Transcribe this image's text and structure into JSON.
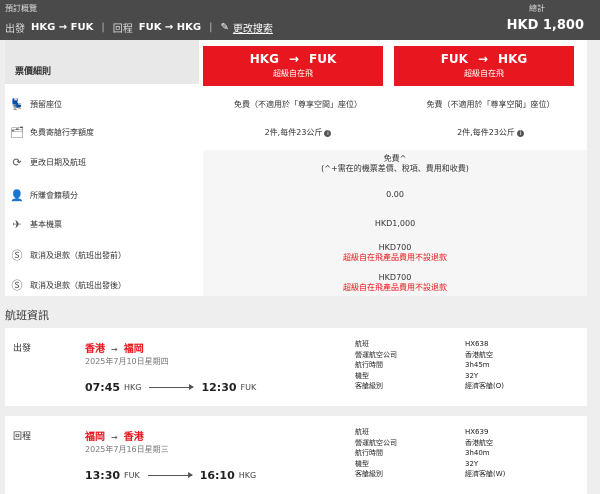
{
  "topbar": {
    "overview_label": "預訂概覽",
    "outbound_label": "出發",
    "outbound_route": "HKG → FUK",
    "return_label": "回程",
    "return_route": "FUK → HKG",
    "edit_label": "更改搜索",
    "total_label": "總計",
    "total_value": "HKD 1,800"
  },
  "fare": {
    "header_label": "票價細則",
    "outbound": {
      "route_from": "HKG",
      "route_to": "FUK",
      "arrow": "→",
      "fare_name": "超級自在飛"
    },
    "return": {
      "route_from": "FUK",
      "route_to": "HKG",
      "arrow": "→",
      "fare_name": "超級自在飛"
    },
    "rows": [
      {
        "label": "預留座位",
        "out": "免費（不適用於「尊享空間」座位）",
        "ret": "免費（不適用於「尊享空間」座位）"
      },
      {
        "label": "免費寄艙行李額度",
        "out": "2件,每件23公斤",
        "ret": "2件,每件23公斤"
      },
      {
        "label": "更改日期及航班",
        "value": "免費^",
        "note": "(^+需在的機票差價、稅項、費用和收費)"
      },
      {
        "label": "所賺會籍積分",
        "value": "0.00"
      },
      {
        "label": "基本機票",
        "value": "HKD1,000"
      },
      {
        "label": "取消及退款（航班出發前）",
        "value": "HKD700",
        "note": "超級自在飛產品費用不設退款"
      },
      {
        "label": "取消及退款（航班出發後）",
        "value": "HKD700",
        "note": "超級自在飛產品費用不設退款"
      }
    ]
  },
  "flight_info_title": "航班資訊",
  "flights": [
    {
      "direction": "出發",
      "from_city": "香港",
      "to_city": "福岡",
      "arrow": "→",
      "date": "2025年7月10日星期四",
      "dep_time": "07:45",
      "dep_airport": "HKG",
      "arr_time": "12:30",
      "arr_airport": "FUK",
      "details": [
        {
          "k": "航班",
          "v": "HX638"
        },
        {
          "k": "營運航空公司",
          "v": "香港航空"
        },
        {
          "k": "航行時間",
          "v": "3h45m"
        },
        {
          "k": "機型",
          "v": "32Y"
        },
        {
          "k": "客艙級別",
          "v": "經濟客艙(O)"
        }
      ]
    },
    {
      "direction": "回程",
      "from_city": "福岡",
      "to_city": "香港",
      "arrow": "→",
      "date": "2025年7月16日星期三",
      "dep_time": "13:30",
      "dep_airport": "FUK",
      "arr_time": "16:10",
      "arr_airport": "HKG",
      "details": [
        {
          "k": "航班",
          "v": "HX639"
        },
        {
          "k": "營運航空公司",
          "v": "香港航空"
        },
        {
          "k": "航行時間",
          "v": "3h40m"
        },
        {
          "k": "機型",
          "v": "32Y"
        },
        {
          "k": "客艙級別",
          "v": "經濟客艙(W)"
        }
      ]
    }
  ],
  "icons": {
    "seat": "seat-icon",
    "baggage": "baggage-icon",
    "change": "refresh-icon",
    "points": "person-icon",
    "fare": "plane-icon",
    "refund": "dollar-icon",
    "info": "info-icon",
    "edit": "edit-icon"
  },
  "colors": {
    "accent": "#e8161e",
    "topbar": "#4a4a4a"
  }
}
